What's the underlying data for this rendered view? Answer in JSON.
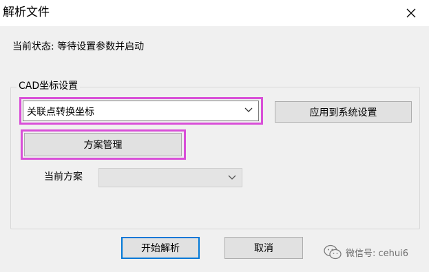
{
  "window": {
    "title": "解析文件"
  },
  "status": {
    "text": "当前状态: 等待设置参数并启动"
  },
  "cad_group": {
    "legend": "CAD坐标设置",
    "coordinate_select": {
      "value": "关联点转换坐标"
    },
    "apply_button": "应用到系统设置",
    "scheme_button": "方案管理",
    "current_scheme_label": "当前方案",
    "current_scheme_select": {
      "value": ""
    }
  },
  "footer": {
    "start_button": "开始解析",
    "cancel_button": "取消"
  },
  "watermark": {
    "text": "微信号: cehui6"
  },
  "colors": {
    "highlight": "#d94fd8",
    "default_button_border": "#0078d7",
    "dialog_bg": "#f0f0f0"
  }
}
